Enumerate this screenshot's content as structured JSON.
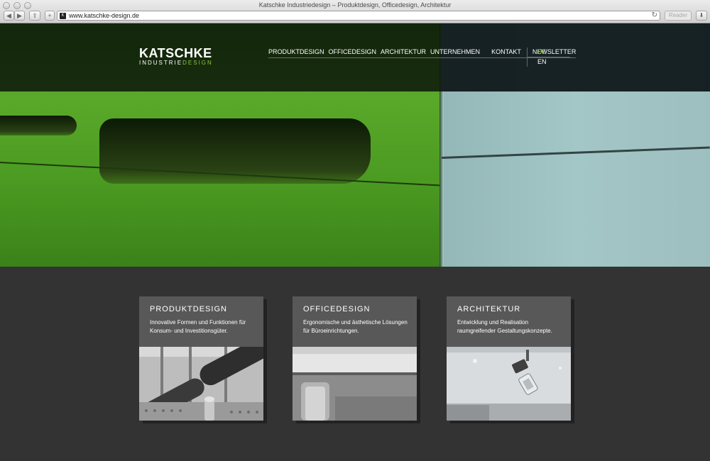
{
  "window": {
    "title": "Katschke Industriedesign – Produktdesign, Officedesign, Architektur",
    "url": "www.katschke-design.de",
    "reader_label": "Reader"
  },
  "header": {
    "logo_main": "KATSCHKE",
    "logo_sub_a": "INDUSTRIE",
    "logo_sub_b": "DESIGN",
    "nav": [
      "PRODUKTDESIGN",
      "OFFICEDESIGN",
      "ARCHITEKTUR",
      "UNTERNEHMEN",
      "KONTAKT",
      "NEWSLETTER"
    ],
    "lang": [
      "DE",
      "EN"
    ],
    "accent_color": "#8dc63f"
  },
  "cards": [
    {
      "title": "PRODUKTDESIGN",
      "desc": "Innovative Formen und Funktionen für Konsum- und Investitionsgüter."
    },
    {
      "title": "OFFICEDESIGN",
      "desc": "Ergonomische und ästhetische Lösungen für Büroeinrichtungen."
    },
    {
      "title": "ARCHITEKTUR",
      "desc": "Entwicklung und Realisation raumgreifender Gestaltungskonzepte."
    }
  ]
}
